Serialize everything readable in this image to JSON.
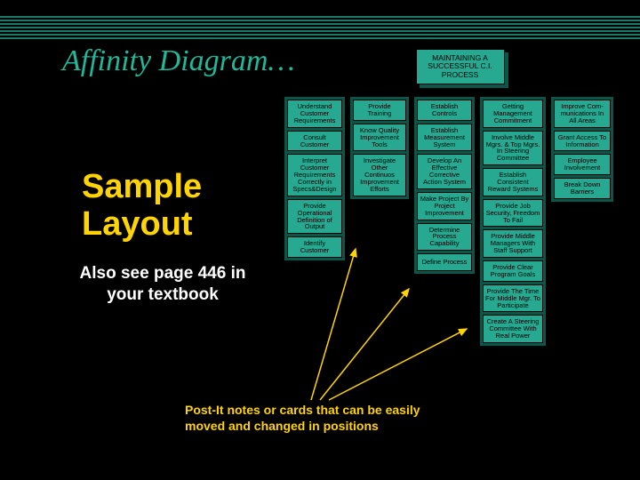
{
  "title": "Affinity Diagram…",
  "sample_heading": "Sample\nLayout",
  "textbook_note": "Also see page 446 in your textbook",
  "postit_note": "Post-It notes or cards that can be easily moved and changed in positions",
  "top_card": "MAINTAINING A SUCCESSFUL C.I. PROCESS",
  "columns": [
    [
      "Understand Customer Requirements",
      "Consult Customer",
      "Interpret Customer Requirements Correctly in Specs&Design",
      "Provide Operational Definition of Output",
      "Identify Customer"
    ],
    [
      "Provide Training",
      "Know Quality Improvement Tools",
      "Investigate Other Continuos Improvement Efforts"
    ],
    [
      "Establish Controls",
      "Establish Measurement System",
      "Develop An Effective Corrective Action System",
      "Make Project By Project Improvement",
      "Determine Process Capability",
      "Define Process"
    ],
    [
      "Getting Management Commitment",
      "Involve Middle Mgrs. & Top Mgrs. In Steering Committee",
      "Establish Consistent Reward Systems",
      "Provide Job Security, Freedom To Fail",
      "Provide Middle Managers With Staff Support",
      "Provide Clear Program Goals",
      "Provide The Time For Middle Mgr. To Participate",
      "Create A Steering Committee With Real Power"
    ],
    [
      "Improve Com-munications In All Areas",
      "Grant Access To Information",
      "Employee Involvement",
      "Break Down Barriers"
    ]
  ],
  "chart_data": {
    "type": "table",
    "title": "Affinity Diagram — Maintaining a Successful C.I. Process",
    "groups": [
      {
        "header": "Understand Customer Requirements",
        "items": [
          "Consult Customer",
          "Interpret Customer Requirements Correctly in Specs&Design",
          "Provide Operational Definition of Output",
          "Identify Customer"
        ]
      },
      {
        "header": "Provide Training",
        "items": [
          "Know Quality Improvement Tools",
          "Investigate Other Continuos Improvement Efforts"
        ]
      },
      {
        "header": "Establish Controls",
        "items": [
          "Establish Measurement System",
          "Develop An Effective Corrective Action System",
          "Make Project By Project Improvement",
          "Determine Process Capability",
          "Define Process"
        ]
      },
      {
        "header": "Getting Management Commitment",
        "items": [
          "Involve Middle Mgrs. & Top Mgrs. In Steering Committee",
          "Establish Consistent Reward Systems",
          "Provide Job Security, Freedom To Fail",
          "Provide Middle Managers With Staff Support",
          "Provide Clear Program Goals",
          "Provide The Time For Middle Mgr. To Participate",
          "Create A Steering Committee With Real Power"
        ]
      },
      {
        "header": "Improve Communications In All Areas",
        "items": [
          "Grant Access To Information",
          "Employee Involvement",
          "Break Down Barriers"
        ]
      }
    ]
  }
}
